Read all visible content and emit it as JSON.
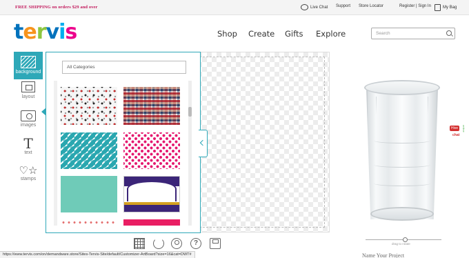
{
  "promo": "FREE SHIPPING on orders $29 and over",
  "topnav": {
    "live_chat": "Live Chat",
    "support": "Support",
    "store_locator": "Store Locator",
    "register_signin": "Register | Sign In",
    "my_bag": "My Bag"
  },
  "logo_letters": [
    "t",
    "e",
    "r",
    "v",
    "i",
    "s"
  ],
  "nav": {
    "shop": "Shop",
    "create": "Create",
    "gifts": "Gifts",
    "explore": "Explore"
  },
  "search": {
    "placeholder": "Search"
  },
  "tools": {
    "background": "background",
    "layout": "layout",
    "images": "images",
    "text": "text",
    "stamps": "stamps"
  },
  "panel": {
    "category": "All Categories"
  },
  "live_chat_badge": {
    "badge": "Hive",
    "text": "chat",
    "side": "online"
  },
  "rotate_label": "drag to rotate",
  "name_project": "Name Your Project",
  "status_url": "https://www.tervis.com/on/demandware.store/Sites-Tervis-Site/default/Customizer-ArtBoard?size=16&cat=DWT#",
  "colors": {
    "accent": "#2ea8b8",
    "promo": "#c2185b"
  }
}
